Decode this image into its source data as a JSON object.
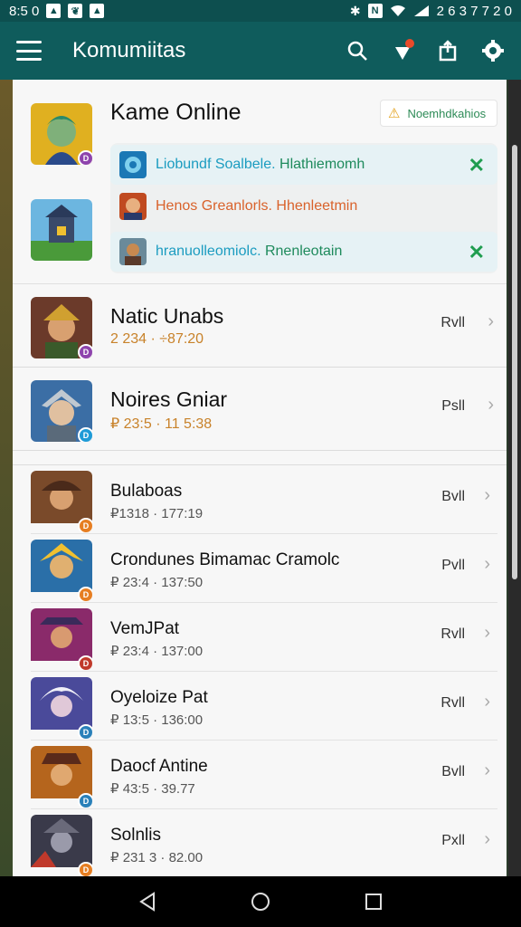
{
  "status_bar": {
    "time": "8:5 0",
    "right_text": "2 6 3 7 7 2 0",
    "left_icons": [
      "image-icon",
      "leaf-icon",
      "notification-icon"
    ],
    "right_icons": [
      "bluetooth-icon",
      "nfc-icon",
      "wifi-icon",
      "signal-icon"
    ]
  },
  "app_bar": {
    "title": "Komumiitas",
    "actions": [
      "search-icon",
      "alert-icon",
      "share-icon",
      "settings-icon"
    ]
  },
  "featured": {
    "title": "Kame Online",
    "notification_label": "Noemhdkahios",
    "sub_items": [
      {
        "text": "Liobundf Soalbele.",
        "extra": "Hlathiemomh",
        "color": "#1b9cc0",
        "extra_color": "#1e8a5c",
        "closable": true
      },
      {
        "text": "Henos Greanlorls.",
        "extra": "Hhenleetmin",
        "color": "#d9622b",
        "extra_color": "#d9622b",
        "closable": false
      },
      {
        "text": "hranuolleomiolc.",
        "extra": "Rnenleotain",
        "color": "#1b9cc0",
        "extra_color": "#1e8a5c",
        "closable": true
      }
    ]
  },
  "big_rows": [
    {
      "title": "Natic Unabs",
      "meta": "2 234  · ÷87:20",
      "action": "Rvll",
      "hue": "#6b3a2a",
      "badge": "#8e44ad"
    },
    {
      "title": "Noires Gniar",
      "meta": "₽ 23:5  · 11 5:38",
      "action": "Psll",
      "hue": "#3b6ea5",
      "badge": "#1e9bd7"
    }
  ],
  "small_rows": [
    {
      "title": "Bulaboas",
      "meta": "₽1318  · 177:19",
      "action": "Bvll",
      "hue": "#7a4a2a",
      "badge": "#e67e22"
    },
    {
      "title": "Crondunes Bimamac Cramolc",
      "meta": "₽ 23:4  · 137:50",
      "action": "Pvll",
      "hue": "#2a6fa8",
      "badge": "#e67e22"
    },
    {
      "title": "VemJPat",
      "meta": "₽ 23:4  · 137:00",
      "action": "Rvll",
      "hue": "#8a2a6a",
      "badge": "#c0392b"
    },
    {
      "title": "Oyeloize Pat",
      "meta": "₽ 13:5  · 136:00",
      "action": "Rvll",
      "hue": "#4a4a9a",
      "badge": "#2980b9"
    },
    {
      "title": "Daocf Antine",
      "meta": "₽ 43:5  · 39.77",
      "action": "Bvll",
      "hue": "#b5651d",
      "badge": "#2980b9"
    },
    {
      "title": "Solnlis",
      "meta": "₽ 231 3  · 82.00",
      "action": "Pxll",
      "hue": "#3a3a4a",
      "badge": "#e67e22"
    }
  ],
  "nav": [
    "back-icon",
    "home-icon",
    "recents-icon"
  ]
}
